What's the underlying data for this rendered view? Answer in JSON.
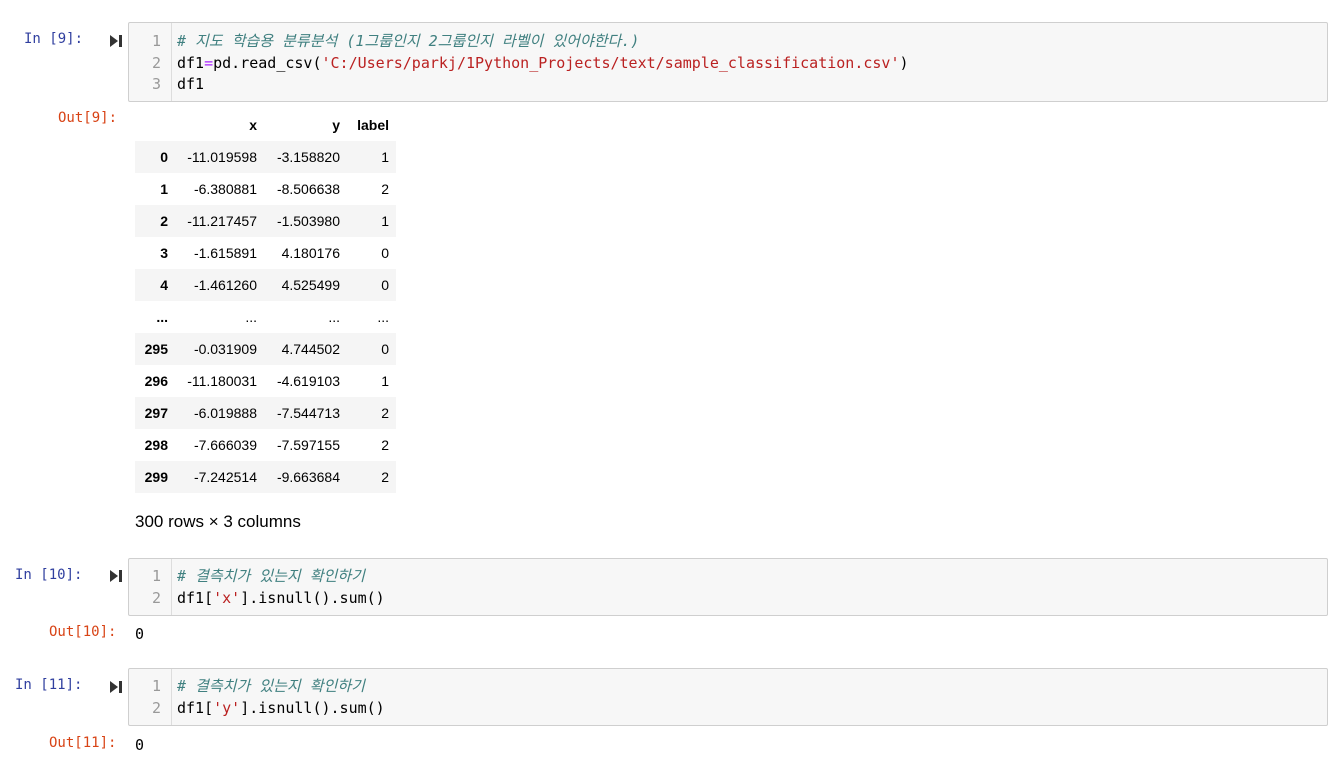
{
  "cells": [
    {
      "in_prompt": "In [9]:",
      "code_lines": [
        {
          "n": "1",
          "comment": "# 지도 학습용 분류분석 (1그룹인지 2그룹인지 라벨이 있어야한다.)"
        },
        {
          "n": "2",
          "a": "df1",
          "op": "=",
          "b": "pd.read_csv(",
          "str": "'C:/Users/parkj/1Python_Projects/text/sample_classification.csv'",
          "c": ")"
        },
        {
          "n": "3",
          "a": "df1"
        }
      ],
      "out_prompt": "Out[9]:",
      "table": {
        "columns": [
          "",
          "x",
          "y",
          "label"
        ],
        "rows": [
          [
            "0",
            "-11.019598",
            "-3.158820",
            "1"
          ],
          [
            "1",
            "-6.380881",
            "-8.506638",
            "2"
          ],
          [
            "2",
            "-11.217457",
            "-1.503980",
            "1"
          ],
          [
            "3",
            "-1.615891",
            "4.180176",
            "0"
          ],
          [
            "4",
            "-1.461260",
            "4.525499",
            "0"
          ],
          [
            "...",
            "...",
            "...",
            "..."
          ],
          [
            "295",
            "-0.031909",
            "4.744502",
            "0"
          ],
          [
            "296",
            "-11.180031",
            "-4.619103",
            "1"
          ],
          [
            "297",
            "-6.019888",
            "-7.544713",
            "2"
          ],
          [
            "298",
            "-7.666039",
            "-7.597155",
            "2"
          ],
          [
            "299",
            "-7.242514",
            "-9.663684",
            "2"
          ]
        ],
        "summary": "300 rows × 3 columns"
      }
    },
    {
      "in_prompt": "In [10]:",
      "code_lines": [
        {
          "n": "1",
          "comment": "# 결측치가 있는지 확인하기"
        },
        {
          "n": "2",
          "a": "df1[",
          "str": "'x'",
          "c": "].isnull().sum()"
        }
      ],
      "out_prompt": "Out[10]:",
      "output": "0"
    },
    {
      "in_prompt": "In [11]:",
      "code_lines": [
        {
          "n": "1",
          "comment": "# 결측치가 있는지 확인하기"
        },
        {
          "n": "2",
          "a": "df1[",
          "str": "'y'",
          "c": "].isnull().sum()"
        }
      ],
      "out_prompt": "Out[11]:",
      "output": "0"
    }
  ],
  "icons": {
    "run": "run-cell-icon"
  }
}
